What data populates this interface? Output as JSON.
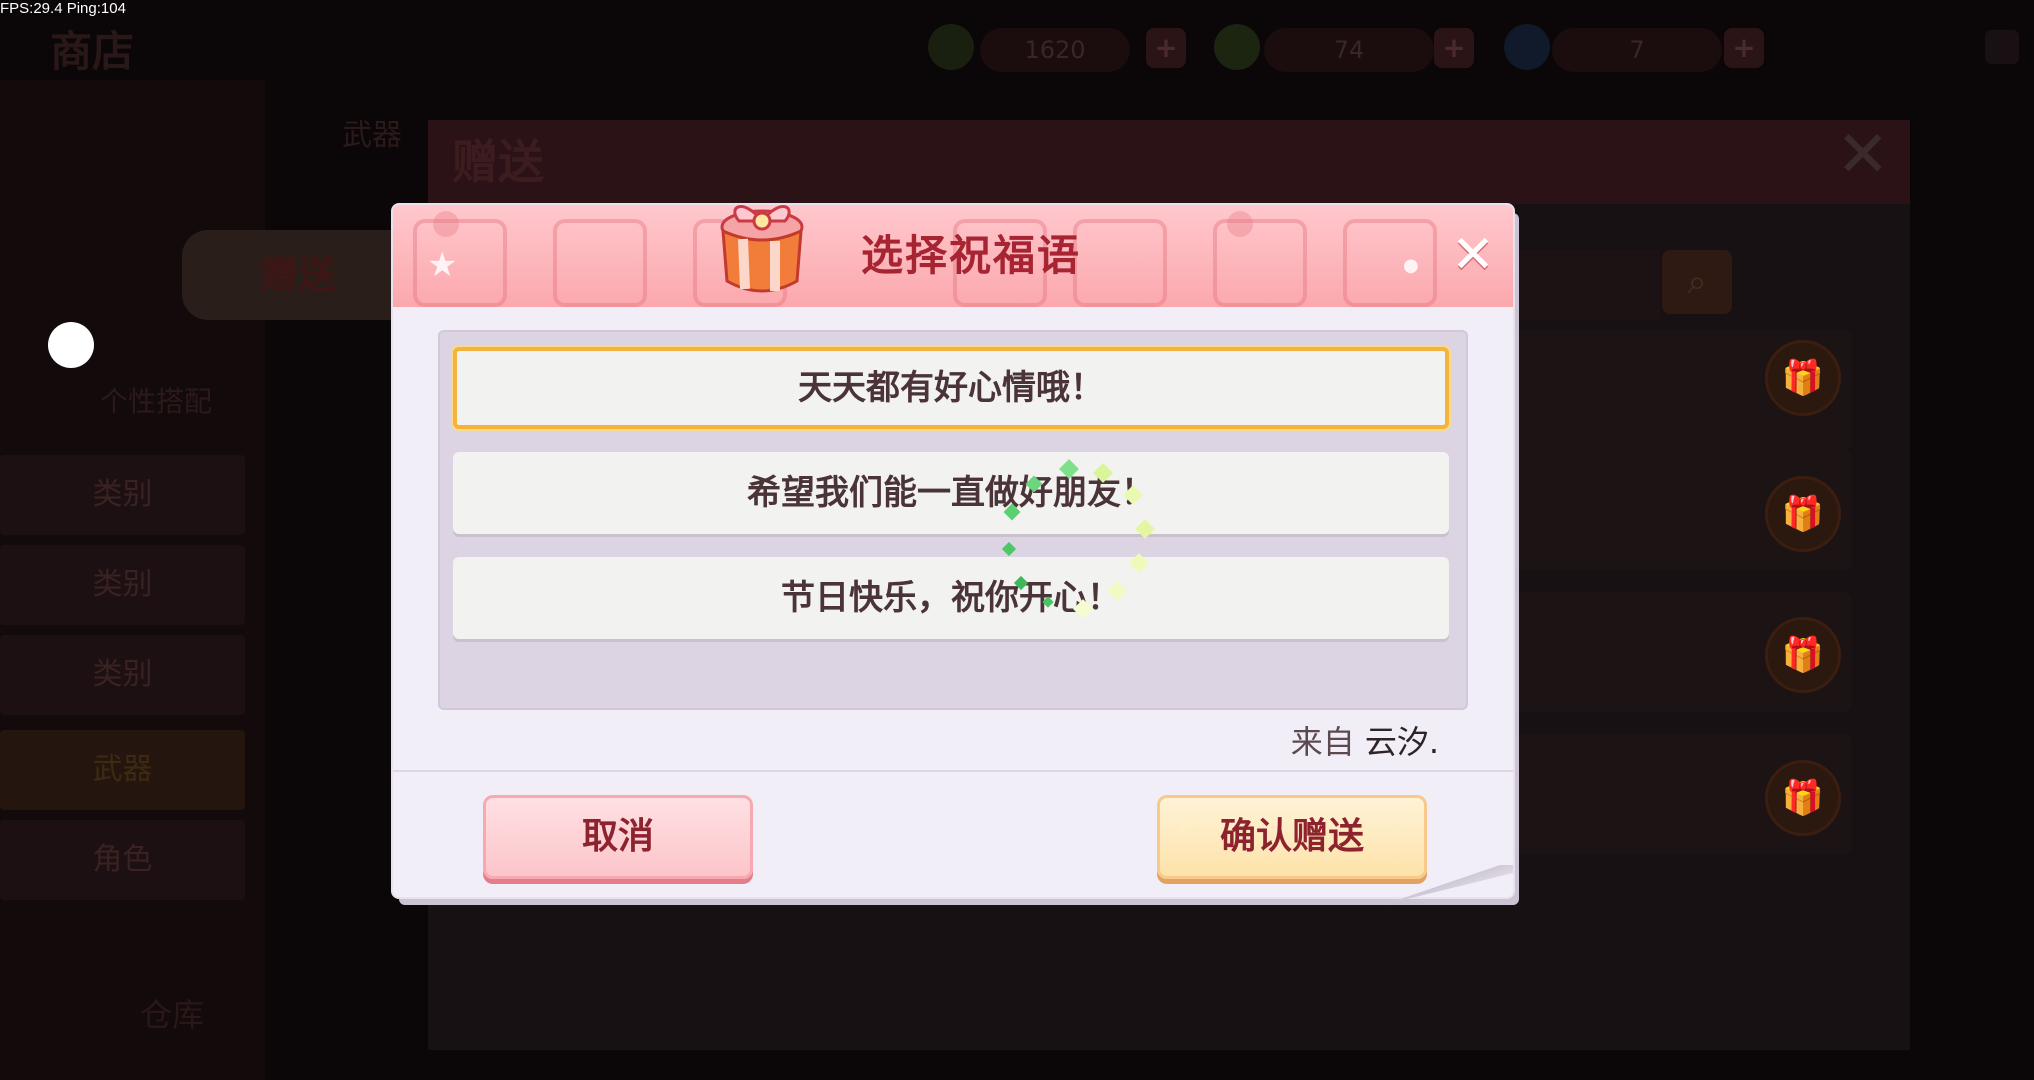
{
  "debug": {
    "fps_text": "FPS:29.4  Ping:104"
  },
  "background": {
    "shop_title": "商店",
    "resources": [
      {
        "value": "1620",
        "color": "#2a2a10"
      },
      {
        "value": "74",
        "color": "#1f2a10"
      },
      {
        "value": "7",
        "color": "#102030"
      }
    ],
    "outer_dialog_title": "赠送",
    "tab_weapon": "武器",
    "tab_gift": "赠送",
    "sub_label": "个性搭配",
    "categories": [
      "类别",
      "类别",
      "类别",
      "武器",
      "角色"
    ],
    "warehouse": "仓库"
  },
  "modal": {
    "title": "选择祝福语",
    "close_icon": "close-icon",
    "gift_icon": "gift-box-icon",
    "messages": [
      {
        "text": "天天都有好心情哦！",
        "selected": true
      },
      {
        "text": "希望我们能一直做好朋友！",
        "selected": false
      },
      {
        "text": "节日快乐，祝你开心！",
        "selected": false
      }
    ],
    "from_label": "来自",
    "from_name": "云汐.",
    "cancel_label": "取消",
    "confirm_label": "确认赠送"
  },
  "colors": {
    "title_red": "#a72532",
    "selected_border": "#f4b33c",
    "header_pink": "#fba8ad"
  }
}
